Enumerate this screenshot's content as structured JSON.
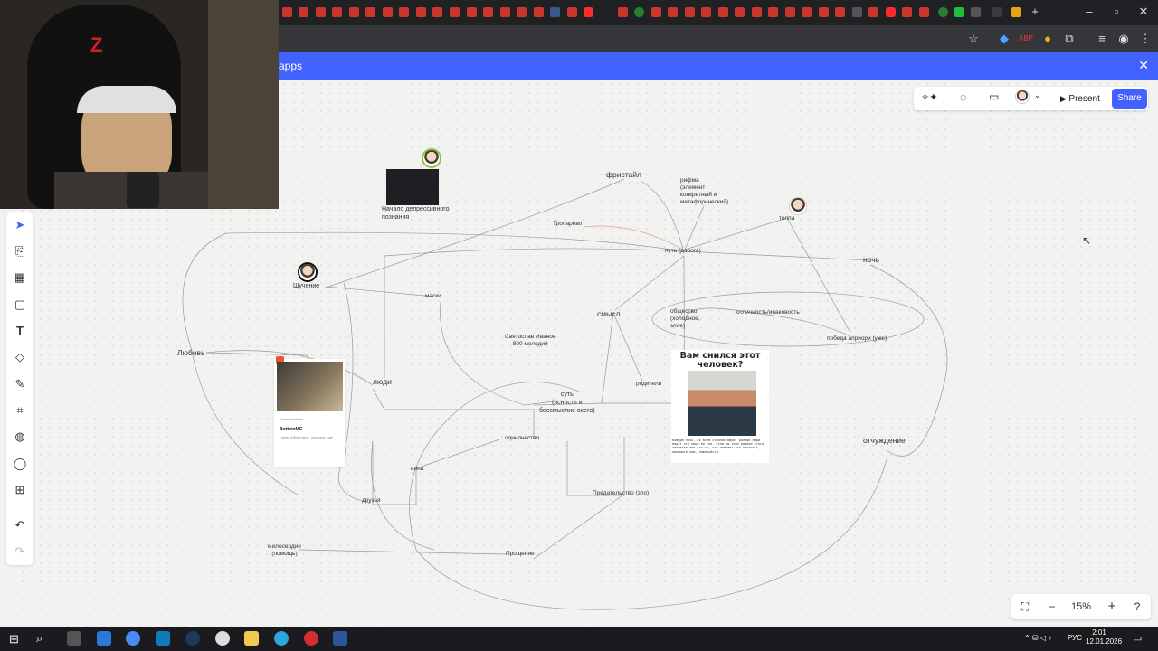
{
  "banner": {
    "link_text": "apps"
  },
  "toolbar": {
    "present_label": "Present",
    "share_label": "Share",
    "zoom": "15%"
  },
  "board": {
    "nodes": {
      "thumb_caption": "Начало депрессивного\nпознания",
      "freestyle": "фристайл",
      "rhyme": "рифма\n(элемент\nконкретный и\nметафорический)",
      "troparevo": "Тропарево",
      "crowd": "толпа",
      "path": "путь (дорога)",
      "night": "ночь",
      "shuchenie": "Шучение",
      "masks": "маски",
      "meaning": "смысл",
      "society": "общество\n(холодное,\nзлое)",
      "difference": "отличность/инаковость",
      "victory": "победа априори (уже)",
      "love": "Любовь",
      "svyatoslav": "Святослав Иванов\n800 мелодий",
      "people": "люди",
      "parents": "родители",
      "essence": "суть\n(ясность и\nбессмыслие всего)",
      "alienation": "отчуждение",
      "loneliness": "одиночество",
      "guilt": "вина",
      "betrayal": "Предательство (зло)",
      "friends": "друзья",
      "mercy": "милосердие\n(помощь)",
      "forgiveness": "Прощение"
    },
    "card1": {
      "title": "BottomMC",
      "tag": "Donationalerts",
      "sub": "Группа в ВКонтакте · Загрузить ещё"
    },
    "card2": {
      "title": "Вам снился этот\nчеловек?",
      "body": "Каждую ночь, во всем странах мира, разные люди видят это лицо во сне. Если вы тоже видели этого человека или кто-то, что поможет его опознать, напишите нам, пожалуйста."
    }
  },
  "taskbar": {
    "time": "2:01",
    "date": "12.01.2026",
    "lang": "РУС"
  },
  "colors": {
    "accent": "#4262ff",
    "taskbar": "#1b1b1f",
    "board": "#f2f2f1"
  }
}
